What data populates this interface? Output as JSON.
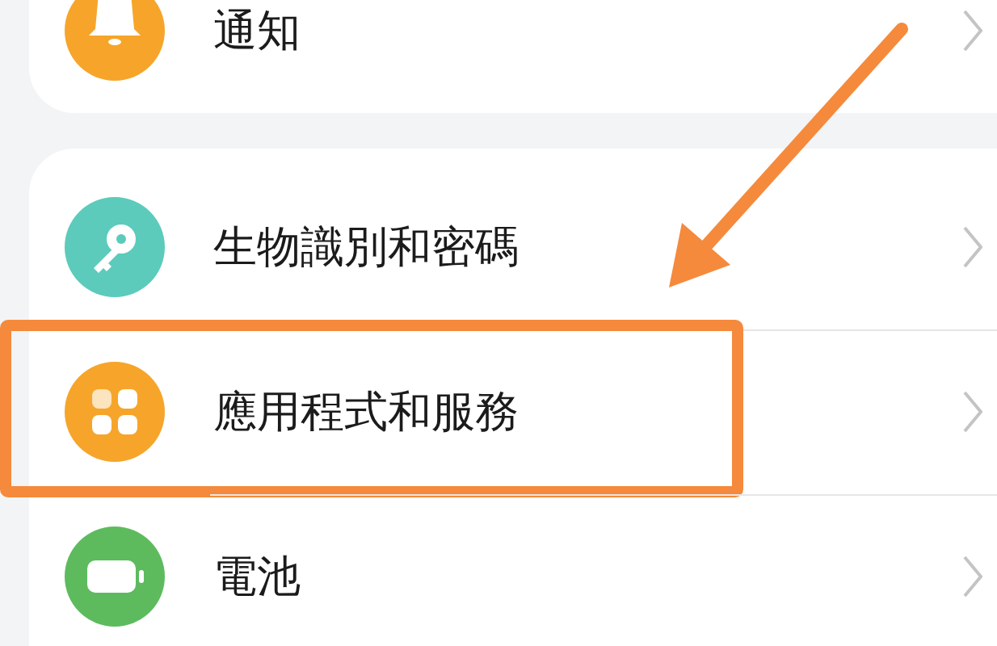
{
  "sections": [
    {
      "items": [
        {
          "label": "通知",
          "kind": "bell",
          "color": "#f6a52a",
          "highlighted": false
        }
      ]
    },
    {
      "items": [
        {
          "label": "生物識別和密碼",
          "kind": "key",
          "color": "#5ccbbb",
          "highlighted": false
        },
        {
          "label": "應用程式和服務",
          "kind": "apps",
          "color": "#f6a52a",
          "highlighted": true
        },
        {
          "label": "電池",
          "kind": "battery",
          "color": "#5dbb5e",
          "highlighted": false
        }
      ]
    }
  ]
}
